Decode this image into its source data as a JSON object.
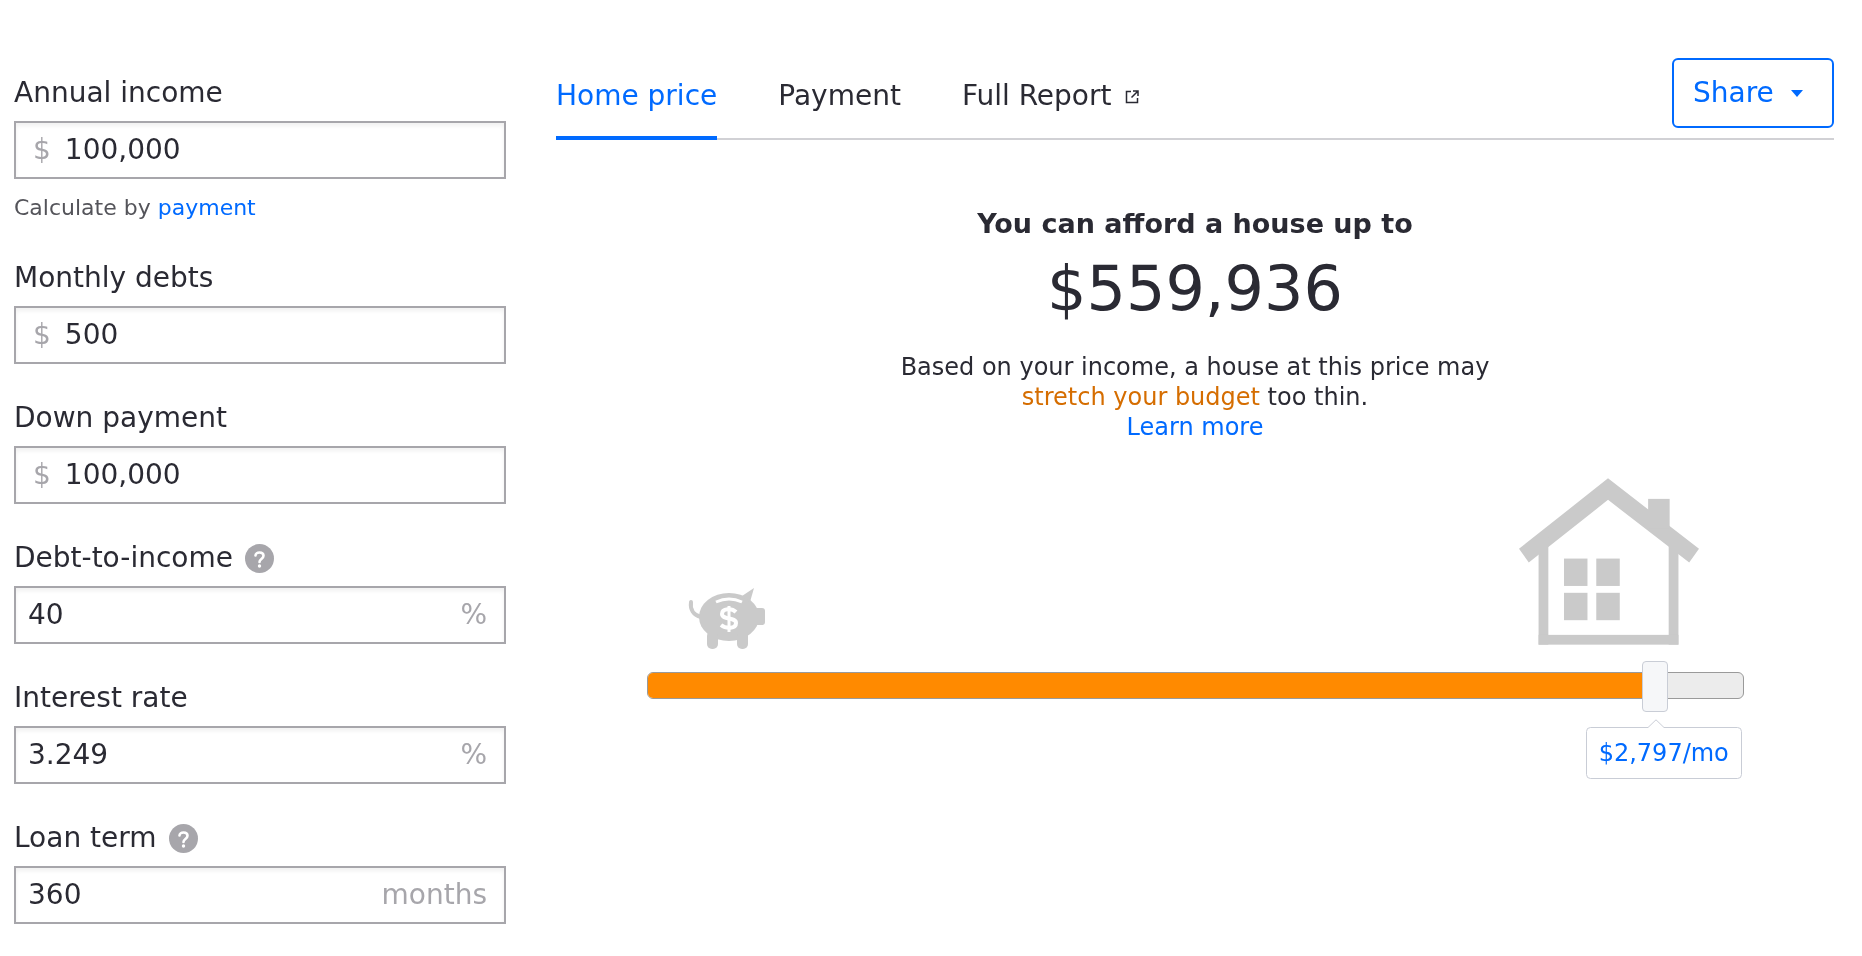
{
  "fields": [
    {
      "label": "Annual income",
      "help": false,
      "prefix": "$",
      "value": "100,000",
      "note": {
        "text": "Calculate by",
        "link": "payment"
      }
    },
    {
      "label": "Monthly debts",
      "help": false,
      "prefix": "$",
      "value": "500"
    },
    {
      "label": "Down payment",
      "help": false,
      "prefix": "$",
      "value": "100,000"
    },
    {
      "label": "Debt-to-income",
      "help": true,
      "value": "40",
      "suffix": "%"
    },
    {
      "label": "Interest rate",
      "help": false,
      "value": "3.249",
      "suffix": "%"
    },
    {
      "label": "Loan term",
      "help": true,
      "value": "360",
      "suffix": "months"
    }
  ],
  "tabs": [
    {
      "label": "Home price",
      "selected": true,
      "external": false
    },
    {
      "label": "Payment",
      "selected": false,
      "external": false
    },
    {
      "label": "Full Report",
      "selected": false,
      "external": true
    }
  ],
  "share_button": {
    "label": "Share"
  },
  "result": {
    "headline": "You can afford a house up to",
    "amount": "$559,936",
    "message": [
      {
        "kind": "plain",
        "text": "Based on your income, a house at this price may "
      },
      {
        "kind": "warning",
        "text": "stretch your budget"
      },
      {
        "kind": "plain",
        "text": " too thin."
      }
    ],
    "learn_more": "Learn more"
  },
  "slider": {
    "level": 0.92,
    "tooltip": "$2,797/mo"
  }
}
